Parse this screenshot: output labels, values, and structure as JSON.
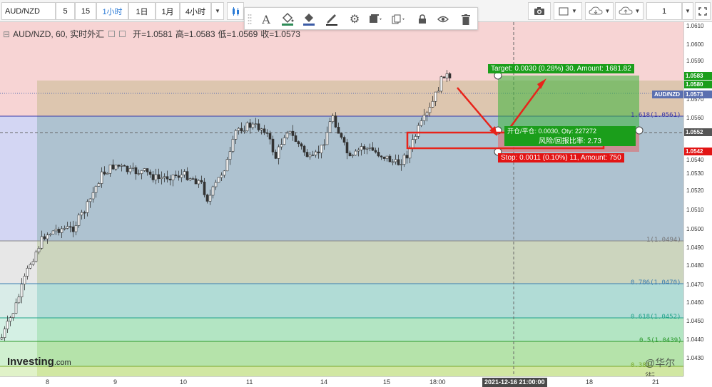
{
  "toolbar": {
    "symbol": "AUD/NZD",
    "intervals": [
      "5",
      "15",
      "1小时",
      "1日",
      "1月",
      "4小时"
    ],
    "selected_interval": "1小时",
    "layout_count": "1"
  },
  "legend": {
    "title": "AUD/NZD, 60, 实时外汇",
    "open": "开=1.0581",
    "high": "高=1.0583",
    "low": "低=1.0569",
    "close": "收=1.0573"
  },
  "drawing_toolbar": {
    "icons": [
      "candle-drag-icon",
      "text-icon",
      "fill-color-icon",
      "line-color-icon",
      "pen-icon",
      "settings-icon",
      "template-icon",
      "clone-icon",
      "lock-icon",
      "eye-icon",
      "trash-icon"
    ]
  },
  "price_axis": {
    "ticks": [
      "1.0610",
      "1.0600",
      "1.0590",
      "1.0570",
      "1.0560",
      "1.0540",
      "1.0530",
      "1.0520",
      "1.0510",
      "1.0500",
      "1.0490",
      "1.0480",
      "1.0470",
      "1.0460",
      "1.0450",
      "1.0440",
      "1.0430"
    ],
    "badges": [
      {
        "text": "1.0583",
        "color": "#1b9e1b"
      },
      {
        "text": "1.0580",
        "color": "#1b9e1b"
      },
      {
        "text": "AUD/NZD",
        "color": "#5a6fb0"
      },
      {
        "text": "1.0573",
        "color": "#5a6fb0"
      },
      {
        "text": "1.0552",
        "color": "#555555"
      },
      {
        "text": "1.0542",
        "color": "#e21414"
      }
    ]
  },
  "time_axis": {
    "ticks": [
      "8",
      "9",
      "10",
      "11",
      "14",
      "15",
      "18:00",
      "18",
      "21"
    ],
    "cursor_label": "2021-12-16 21:00:00"
  },
  "fib_levels": [
    {
      "label": "1.618(1.0561)",
      "color": "#3a3aa8"
    },
    {
      "label": "1(1.0494)",
      "color": "#777777"
    },
    {
      "label": "0.786(1.0470)",
      "color": "#3a7db0"
    },
    {
      "label": "0.618(1.0452)",
      "color": "#22a48a"
    },
    {
      "label": "0.5(1.0439)",
      "color": "#2c9a2c"
    },
    {
      "label": "0.382",
      "color": "#7aaa2a"
    }
  ],
  "position_tool": {
    "target": "Target: 0.0030 (0.28%) 30, Amount: 1681.82",
    "stop": "Stop: 0.0011 (0.10%) 11, Amount: 750",
    "entry": "开仓/平仓: 0.0030, Qty: 227272",
    "ratio": "风险/回报比率: 2.73"
  },
  "brand": {
    "name": "Investing",
    "suffix": ".com"
  },
  "watermark": "@华尔街",
  "colors": {
    "accent": "#2b7bd6",
    "candle": "#333333",
    "profit": "#1b9e1b",
    "loss": "#e21414",
    "annotation": "#e8231a"
  }
}
